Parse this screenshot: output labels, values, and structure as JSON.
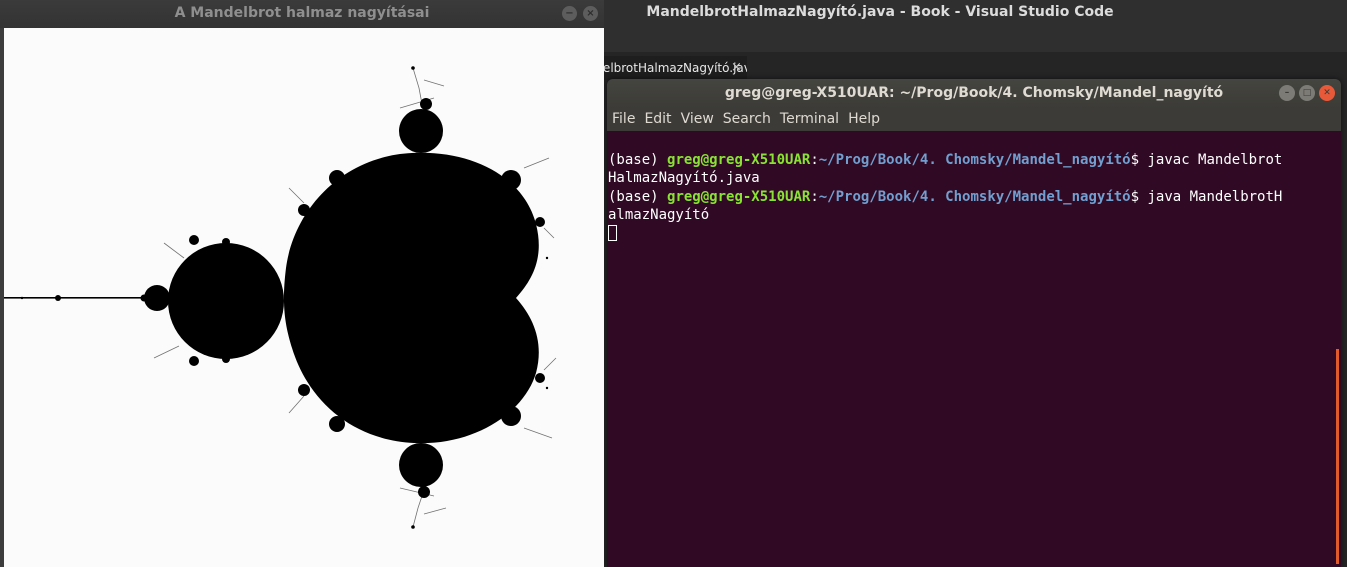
{
  "java_window": {
    "title": "A Mandelbrot halmaz nagyításai",
    "minimize_glyph": "−",
    "close_glyph": "×"
  },
  "vscode": {
    "title": "MandelbrotHalmazNagyító.java - Book - Visual Studio Code",
    "tab_label": "MandelbrotHalmazNagyító.java",
    "tab_close": "×"
  },
  "terminal": {
    "title": "greg@greg-X510UAR: ~/Prog/Book/4. Chomsky/Mandel_nagyító",
    "menu": [
      "File",
      "Edit",
      "View",
      "Search",
      "Terminal",
      "Help"
    ],
    "lines": [
      {
        "env": "(base) ",
        "user": "greg@greg-X510UAR",
        "sep": ":",
        "path": "~/Prog/Book/4. Chomsky/Mandel_nagyító",
        "cmd": "$ javac MandelbrotHalmazNagyító.java"
      },
      {
        "env": "(base) ",
        "user": "greg@greg-X510UAR",
        "sep": ":",
        "path": "~/Prog/Book/4. Chomsky/Mandel_nagyító",
        "cmd": "$ java MandelbrotHalmazNagyító"
      }
    ]
  },
  "colors": {
    "terminal_bg": "#300a24",
    "prompt_user": "#8ae234",
    "prompt_path": "#729fcf",
    "close_button": "#e8593a"
  }
}
